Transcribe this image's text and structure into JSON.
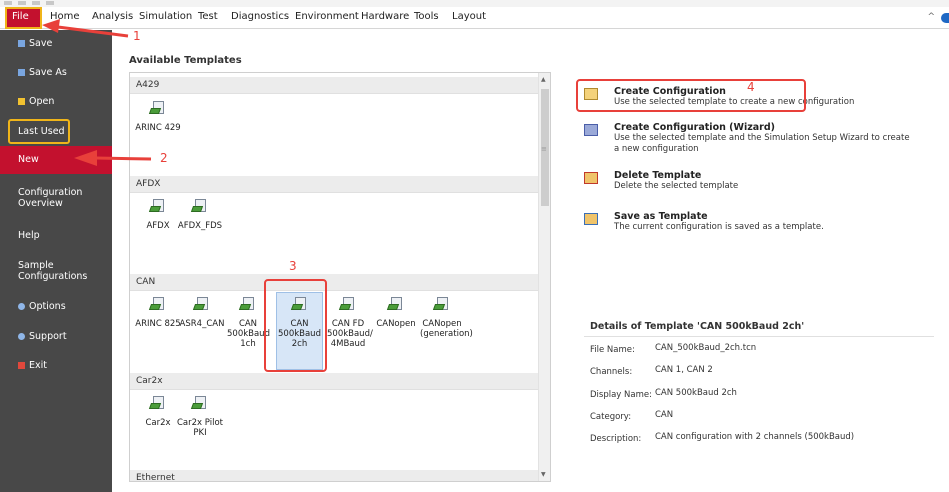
{
  "menubar": {
    "file": "File",
    "items": [
      "Home",
      "Analysis",
      "Simulation",
      "Test",
      "Diagnostics",
      "Environment",
      "Hardware",
      "Tools",
      "Layout"
    ]
  },
  "sidebar": {
    "items": [
      {
        "label": "Save",
        "icon": "save-icon"
      },
      {
        "label": "Save As",
        "icon": "save-as-icon"
      },
      {
        "label": "Open",
        "icon": "folder-icon"
      },
      {
        "label": "Last Used",
        "icon": ""
      },
      {
        "label": "New",
        "icon": ""
      },
      {
        "label": "Configuration Overview",
        "icon": ""
      },
      {
        "label": "Help",
        "icon": ""
      },
      {
        "label": "Sample Configurations",
        "icon": ""
      },
      {
        "label": "Options",
        "icon": "options-icon"
      },
      {
        "label": "Support",
        "icon": "support-icon"
      },
      {
        "label": "Exit",
        "icon": "exit-icon"
      }
    ]
  },
  "templates": {
    "title": "Available Templates",
    "groups": [
      {
        "name": "A429",
        "items": [
          "ARINC 429"
        ]
      },
      {
        "name": "AFDX",
        "items": [
          "AFDX",
          "AFDX_FDS"
        ]
      },
      {
        "name": "CAN",
        "items": [
          "ARINC 825",
          "ASR4_CAN",
          "CAN 500kBaud 1ch",
          "CAN 500kBaud 2ch",
          "CAN FD 500kBaud/ 4MBaud",
          "CANopen",
          "CANopen (generation)"
        ]
      },
      {
        "name": "Car2x",
        "items": [
          "Car2x",
          "Car2x Pilot PKI"
        ]
      },
      {
        "name": "Ethernet",
        "items": []
      }
    ],
    "selected": "CAN 500kBaud 2ch"
  },
  "actions": [
    {
      "title": "Create Configuration",
      "desc": "Use the selected template to create a new configuration"
    },
    {
      "title": "Create Configuration (Wizard)",
      "desc": "Use the selected template and the Simulation Setup Wizard to create a new configuration"
    },
    {
      "title": "Delete Template",
      "desc": "Delete the selected template"
    },
    {
      "title": "Save as Template",
      "desc": "The current configuration is saved as a template."
    }
  ],
  "details": {
    "title": "Details of Template 'CAN 500kBaud 2ch'",
    "rows": [
      {
        "label": "File Name:",
        "value": "CAN_500kBaud_2ch.tcn"
      },
      {
        "label": "Channels:",
        "value": "CAN 1, CAN 2"
      },
      {
        "label": "Display Name:",
        "value": "CAN 500kBaud 2ch"
      },
      {
        "label": "Category:",
        "value": "CAN"
      },
      {
        "label": "Description:",
        "value": "CAN configuration with 2 channels (500kBaud)"
      }
    ]
  },
  "annotations": [
    "1",
    "2",
    "3",
    "4"
  ],
  "colors": {
    "accent_red": "#c3112e",
    "highlight_yellow": "#f0b51a",
    "annotation_red": "#e8403a",
    "sidebar_bg": "#484848"
  }
}
